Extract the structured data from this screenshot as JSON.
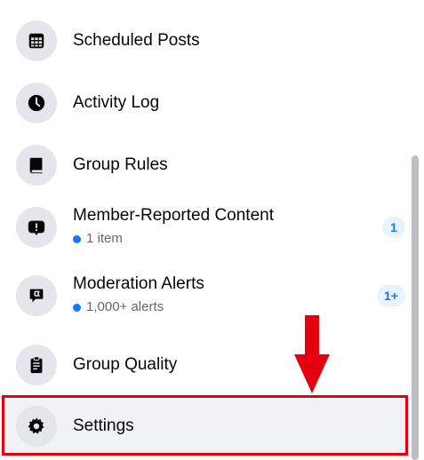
{
  "menu": {
    "items": [
      {
        "label": "Scheduled Posts",
        "icon": "calendar-grid-icon"
      },
      {
        "label": "Activity Log",
        "icon": "clock-icon"
      },
      {
        "label": "Group Rules",
        "icon": "book-icon"
      },
      {
        "label": "Member-Reported Content",
        "icon": "exclamation-bubble-icon",
        "sub": "1 item",
        "badge": "1"
      },
      {
        "label": "Moderation Alerts",
        "icon": "flag-bubble-icon",
        "sub": "1,000+ alerts",
        "badge": "1+"
      },
      {
        "label": "Group Quality",
        "icon": "clipboard-icon"
      },
      {
        "label": "Settings",
        "icon": "gear-icon",
        "selected": true
      }
    ]
  },
  "annotation": {
    "color": "#e5000f",
    "arrow_direction": "down"
  },
  "colors": {
    "accent": "#1877f2",
    "icon_bg": "#e4e6eb",
    "active_bg": "#f0f2f5"
  }
}
